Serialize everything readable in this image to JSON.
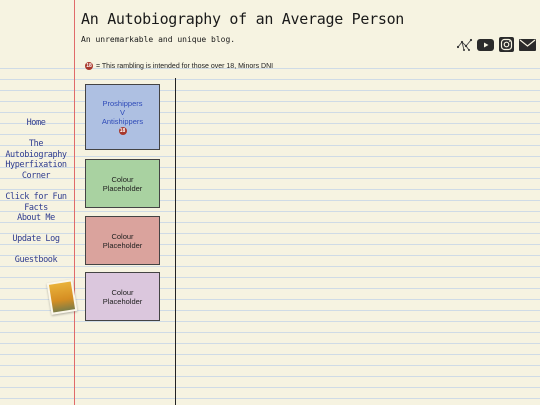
{
  "header": {
    "title": "An Autobiography of an Average Person",
    "tagline": "An unremarkable and unique blog."
  },
  "socials": [
    {
      "name": "constellation-icon"
    },
    {
      "name": "youtube-icon"
    },
    {
      "name": "instagram-icon"
    },
    {
      "name": "mail-icon"
    }
  ],
  "notice": {
    "badge": "18",
    "text": "= This rambling is intended for those over 18, Minors DNI"
  },
  "nav": {
    "items": [
      {
        "label": "Home"
      },
      {
        "label": "The Autobiography"
      },
      {
        "label": "Hyperfixation Corner"
      },
      {
        "label": "Click for Fun Facts"
      },
      {
        "label": "About Me"
      },
      {
        "label": "Update Log"
      },
      {
        "label": "Guestbook"
      }
    ]
  },
  "cards": [
    {
      "lines": [
        "Proshippers",
        "V",
        "Antishippers"
      ],
      "badge": "18"
    },
    {
      "lines": [
        "Colour",
        "Placeholder"
      ]
    },
    {
      "lines": [
        "Colour",
        "Placeholder"
      ]
    },
    {
      "lines": [
        "Colour",
        "Placeholder"
      ]
    }
  ],
  "colors": {
    "background": "#f6f3e1",
    "margin_line": "#e06a6a",
    "nav_text": "#2f3c8f",
    "card1": "#aec0e2",
    "card2": "#a9d2a1",
    "card3": "#daa39d",
    "card4": "#dbc7dd"
  }
}
